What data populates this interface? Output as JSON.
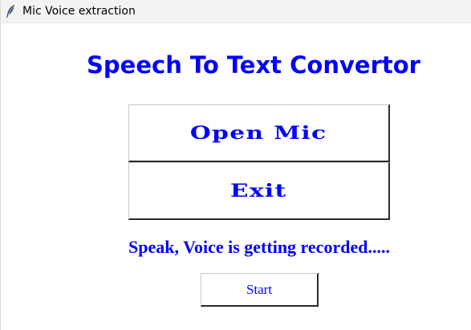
{
  "window": {
    "title": "Mic Voice extraction",
    "icon": "feather-icon"
  },
  "heading": "Speech To Text Convertor",
  "buttons": {
    "open_mic": "Open Mic",
    "exit": "Exit",
    "start": "Start"
  },
  "status": "Speak, Voice is getting recorded.....",
  "colors": {
    "accent": "#0000ff",
    "background": "#ffffff",
    "titlebar": "#f3f3f3"
  }
}
